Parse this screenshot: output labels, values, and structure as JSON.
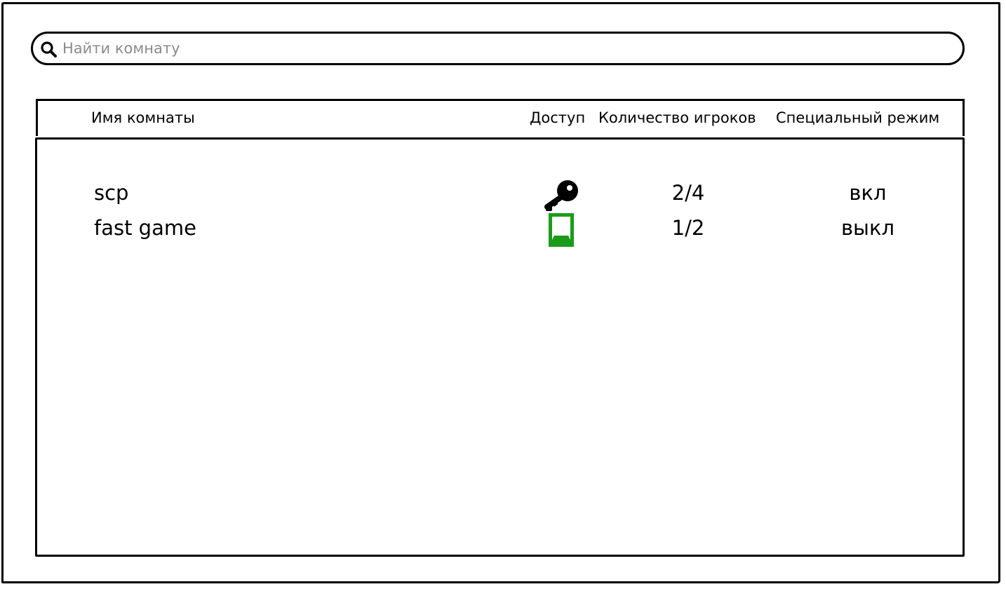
{
  "search": {
    "placeholder": "Найти комнату",
    "icon": "search-icon"
  },
  "table": {
    "columns": {
      "name": "Имя комнаты",
      "access": "Доступ",
      "players": "Количество игроков",
      "mode": "Специальный режим"
    },
    "rows": [
      {
        "name": "scp",
        "access_icon": "key-icon",
        "access_color": "#000000",
        "players": "2/4",
        "mode": "вкл"
      },
      {
        "name": "fast game",
        "access_icon": "open-door-icon",
        "access_color": "#1a9c1a",
        "players": "1/2",
        "mode": "выкл"
      }
    ]
  }
}
